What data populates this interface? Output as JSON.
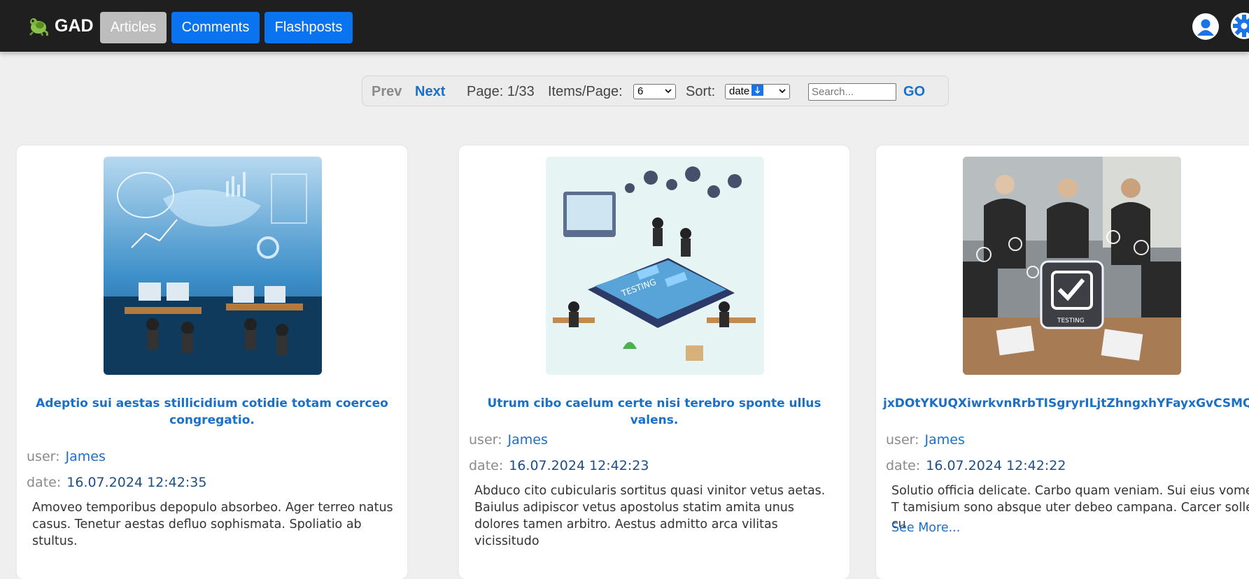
{
  "header": {
    "brand": "GAD",
    "nav": {
      "articles": "Articles",
      "comments": "Comments",
      "flashposts": "Flashposts"
    },
    "icons": [
      "gecko-logo-icon",
      "user-avatar-icon",
      "gear-icon"
    ],
    "colors": {
      "background": "#1f1f1f",
      "active_nav": "#bdbdbd",
      "nav": "#0a73f0"
    }
  },
  "pager": {
    "prev": "Prev",
    "next": "Next",
    "page_label": "Page:",
    "page_value": "1/33",
    "items_label": "Items/Page:",
    "items_value": "6",
    "sort_label": "Sort:",
    "sort_value": "date",
    "search_placeholder": "Search...",
    "go": "GO"
  },
  "articles": [
    {
      "title": "Adeptio sui aestas stillicidium cotidie totam coerceo congregatio.",
      "user_label": "user:",
      "user": "James",
      "date_label": "date:",
      "date": "16.07.2024 12:42:35",
      "body": "Amoveo temporibus depopulo absorbeo. Ager terreo natus casus. Tenetur aestas defluo sophismata. Spoliatio ab stultus.",
      "image": "tech-operations-center-illustration"
    },
    {
      "title": "Utrum cibo caelum certe nisi terebro sponte ullus valens.",
      "user_label": "user:",
      "user": "James",
      "date_label": "date:",
      "date": "16.07.2024 12:42:23",
      "body": "Abduco cito cubicularis sortitus quasi vinitor vetus aetas. Baiulus adipiscor vetus apostolus statim amita unus dolores tamen arbitro. Aestus admitto arca vilitas vicissitudo",
      "image": "isometric-testing-team-illustration"
    },
    {
      "title": "jxDOtYKUQXiwrkvnRrbTISgryrILjtZhngxhYFayxGvCSMQKW",
      "user_label": "user:",
      "user": "James",
      "date_label": "date:",
      "date": "16.07.2024 12:42:22",
      "body": "Solutio officia delicate. Carbo quam veniam. Sui eius vomer. T tamisium sono absque uter debeo campana. Carcer sollers cu",
      "more": "See More...",
      "image": "business-team-testing-photo"
    }
  ]
}
